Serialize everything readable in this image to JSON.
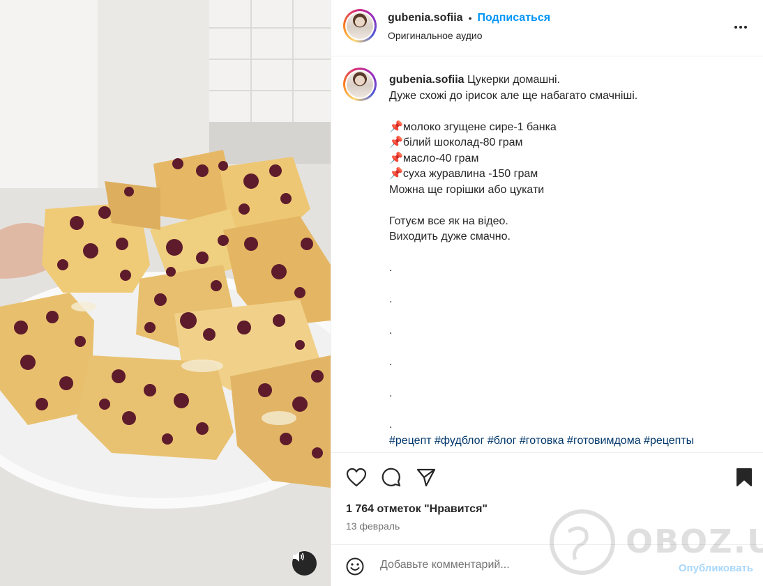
{
  "post": {
    "username": "gubenia.sofiia",
    "separator": "•",
    "follow_label": "Подписаться",
    "audio_label": "Оригинальное аудио"
  },
  "caption": {
    "username": "gubenia.sofiia",
    "first_line": " Цукерки домашні.",
    "lines": [
      "Дуже схожі до ірисок але ще набагато смачніші.",
      "",
      "📌молоко згущене сире-1 банка",
      "📌білий шоколад-80 грам",
      "📌масло-40 грам",
      "📌суха журавлина -150 грам",
      "Можна ще горішки або цукати",
      "",
      "Готуєм все як на відео.",
      "Виходить дуже смачно.",
      "",
      ".",
      "",
      ".",
      "",
      ".",
      "",
      ".",
      "",
      ".",
      "",
      "."
    ],
    "hashtags": "#рецепт #фудблог #блог #готовка #готовимдома #рецепты"
  },
  "actions": {
    "likes": "1 764 отметок \"Нравится\"",
    "date": "13 февраль"
  },
  "comment": {
    "placeholder": "Добавьте комментарий...",
    "publish_label": "Опубликовать"
  },
  "watermark": {
    "text": "OBOZ.UA"
  },
  "icons": {
    "like": "heart-icon",
    "comment": "comment-icon",
    "share": "share-icon",
    "save": "bookmark-icon",
    "more": "more-icon",
    "audio": "speaker-icon",
    "emoji": "emoji-icon"
  }
}
